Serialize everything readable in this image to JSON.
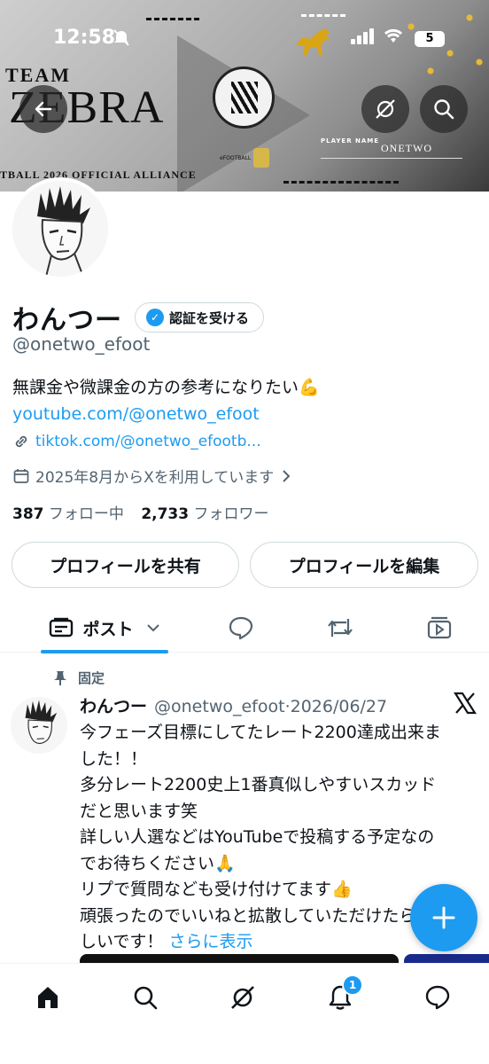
{
  "status_bar": {
    "time": "12:58",
    "battery": "5"
  },
  "banner": {
    "team": "TEAM",
    "title": "ZEBRA",
    "alliance": "TBALL 2026 OFFICIAL ALLIANCE",
    "player_name_label": "PLAYER NAME",
    "player_name": "ONETWO",
    "mini_logo_text": "eFOOTBALL"
  },
  "profile": {
    "display_name": "わんつー",
    "verify_label": "認証を受ける",
    "handle": "@onetwo_efoot",
    "bio_text": "無課金や微課金の方の参考になりたい💪",
    "bio_link": "youtube.com/@onetwo_efoot",
    "link": "tiktok.com/@onetwo_efootb...",
    "joined": "2025年8月からXを利用しています",
    "following_count": "387",
    "following_label": "フォロー中",
    "followers_count": "2,733",
    "followers_label": "フォロワー",
    "share_label": "プロフィールを共有",
    "edit_label": "プロフィールを編集"
  },
  "tabs": {
    "posts_label": "ポスト"
  },
  "pinned_post": {
    "pinned_label": "固定",
    "author": "わんつー",
    "meta": "@onetwo_efoot·2026/06/27",
    "lines": [
      "今フェーズ目標にしてたレート2200達成出来ま",
      "した！！",
      "多分レート2200史上1番真似しやすいスカッド",
      "だと思います笑",
      "詳しい人選などはYouTubeで投稿する予定なの",
      "でお待ちください🙏",
      "リプで質問なども受け付けてます👍",
      "頑張ったのでいいねと拡散していただけたら嬉"
    ],
    "last_line": "しいです！",
    "show_more": "さらに表示"
  },
  "bottom_nav": {
    "notification_count": "1"
  },
  "colors": {
    "accent": "#1d9bf0",
    "text": "#0f1419",
    "muted": "#536471"
  }
}
